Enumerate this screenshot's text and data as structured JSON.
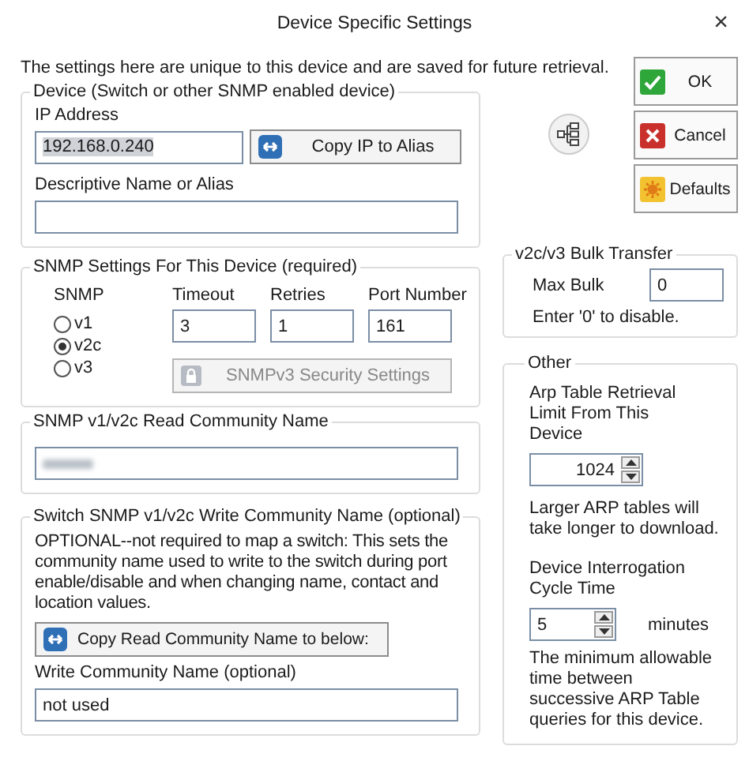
{
  "window": {
    "title": "Device Specific Settings",
    "close": "×"
  },
  "intro": "The settings here are unique to this device and are saved for future retrieval.",
  "device_group": {
    "legend": "Device (Switch or other SNMP enabled device)",
    "ip_label": "IP Address",
    "ip_value": "192.168.0.240",
    "ip_value_highlighted": true,
    "copy_button": "Copy IP to Alias",
    "alias_label": "Descriptive Name or Alias"
  },
  "snmp_group": {
    "legend": "SNMP Settings For This Device (required)",
    "snmp_label": "SNMP",
    "versions": [
      {
        "label": "v1",
        "selected": false
      },
      {
        "label": "v2c",
        "selected": true
      },
      {
        "label": "v3",
        "selected": false
      }
    ],
    "fields": [
      {
        "label": "Timeout",
        "value": "3"
      },
      {
        "label": "Retries",
        "value": "1"
      },
      {
        "label": "Port Number",
        "value": "161"
      }
    ],
    "security_button": {
      "label": "SNMPv3 Security Settings",
      "disabled": true
    }
  },
  "read_group": {
    "legend": "SNMP v1/v2c Read Community Name"
  },
  "write_group": {
    "legend": "Switch SNMP v1/v2c Write Community Name (optional)",
    "description": "OPTIONAL--not required to map a switch: This sets the community name used to write to the switch during port enable/disable and when changing name, contact and location values.",
    "copy_button": "Copy Read Community Name to below:",
    "field_label": "Write Community Name (optional)",
    "value": "not used"
  },
  "actions": [
    {
      "label": "OK",
      "kind": "ok"
    },
    {
      "label": "Cancel",
      "kind": "cancel"
    },
    {
      "label": "Defaults",
      "kind": "defaults"
    }
  ],
  "bulk_group": {
    "legend": "v2c/v3 Bulk Transfer",
    "label": "Max Bulk",
    "value": "0",
    "hint": "Enter '0' to disable."
  },
  "other_group": {
    "legend": "Other",
    "arp_label": "Arp Table Retrieval Limit From This Device",
    "arp_value": "1024",
    "arp_hint": "Larger ARP tables will take longer to download.",
    "cycle_label": "Device Interrogation Cycle Time",
    "cycle_value": "5",
    "cycle_unit": "minutes",
    "cycle_hint": "The minimum allowable time between successive ARP Table queries for this device."
  }
}
